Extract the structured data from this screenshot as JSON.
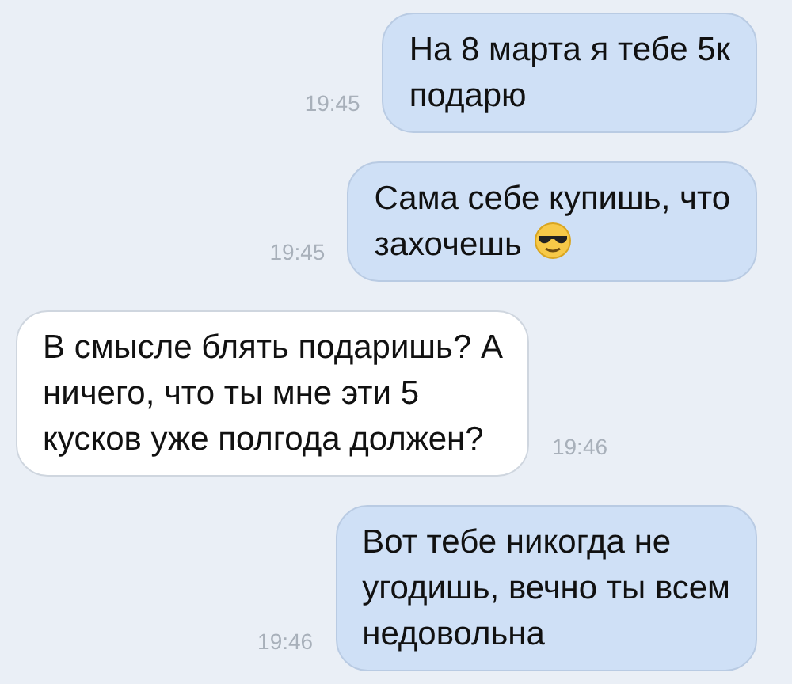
{
  "messages": [
    {
      "kind": "outgoing",
      "lines": [
        "На 8 марта я тебе 5к",
        "подарю"
      ],
      "time": "19:45",
      "emoji": false
    },
    {
      "kind": "outgoing",
      "lines": [
        "Сама себе купишь, что",
        "захочешь"
      ],
      "time": "19:45",
      "emoji": true
    },
    {
      "kind": "incoming",
      "lines": [
        "В смысле блять подаришь? А",
        "ничего, что ты мне эти 5",
        "кусков уже полгода должен?"
      ],
      "time": "19:46",
      "emoji": false
    },
    {
      "kind": "outgoing",
      "lines": [
        "Вот тебе никогда не",
        "угодишь, вечно ты всем",
        "недовольна"
      ],
      "time": "19:46",
      "emoji": false
    }
  ]
}
